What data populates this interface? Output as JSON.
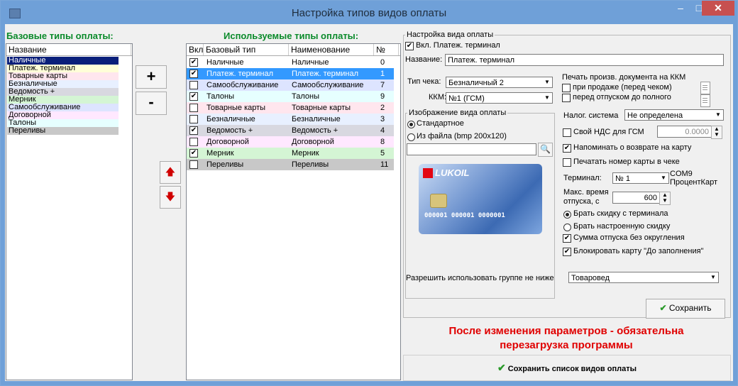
{
  "window": {
    "title": "Настройка типов видов оплаты",
    "min": "–",
    "max": "□",
    "close": "✕"
  },
  "base_types": {
    "header": "Базовые типы оплаты:",
    "column": "Название",
    "items": [
      "Наличные",
      "Платеж. терминал",
      "Товарные карты",
      "Безналичные",
      "Ведомость +",
      "Мерник",
      "Самообслуживание",
      "Договорной",
      "Талоны",
      "Переливы"
    ],
    "colors": [
      "#0a1f7a",
      "#ffffd8",
      "#ffe6ee",
      "#e8f0ff",
      "#d8d8e0",
      "#d4f5d4",
      "#dde4ff",
      "#ffe8ff",
      "#e6ffff",
      "#c8c8c8"
    ]
  },
  "buttons": {
    "add": "+",
    "remove": "-",
    "up": "🡅",
    "down": "🡇"
  },
  "used_types": {
    "header": "Используемые типы оплаты:",
    "columns": [
      "Вкл",
      "Базовый тип",
      "Наименование",
      "№"
    ],
    "rows": [
      {
        "checked": "✔",
        "base": "Наличные",
        "name": "Наличные",
        "num": "0",
        "color": "#ffffff"
      },
      {
        "checked": "✔",
        "base": "Платеж. терминал",
        "name": "Платеж. терминал",
        "num": "1",
        "color": "#3399ff"
      },
      {
        "checked": "",
        "base": "Самообслуживание",
        "name": "Самообслуживание",
        "num": "7",
        "color": "#dde4ff"
      },
      {
        "checked": "✔",
        "base": "Талоны",
        "name": "Талоны",
        "num": "9",
        "color": "#e6ffff"
      },
      {
        "checked": "",
        "base": "Товарные карты",
        "name": "Товарные карты",
        "num": "2",
        "color": "#ffe6ee"
      },
      {
        "checked": "",
        "base": "Безналичные",
        "name": "Безналичные",
        "num": "3",
        "color": "#e8f0ff"
      },
      {
        "checked": "✔",
        "base": "Ведомость +",
        "name": "Ведомость +",
        "num": "4",
        "color": "#d8d8e0"
      },
      {
        "checked": "",
        "base": "Договорной",
        "name": "Договорной",
        "num": "8",
        "color": "#ffe8ff"
      },
      {
        "checked": "✔",
        "base": "Мерник",
        "name": "Мерник",
        "num": "5",
        "color": "#d4f5d4"
      },
      {
        "checked": "",
        "base": "Переливы",
        "name": "Переливы",
        "num": "11",
        "color": "#c8c8c8"
      }
    ]
  },
  "settings": {
    "group_title": "Настройка вида оплаты",
    "enabled_label": "Вкл. Платеж. терминал",
    "name_label": "Название:",
    "name_value": "Платеж. терминал",
    "receipt_type_label": "Тип чека:",
    "receipt_type_value": "Безналичный 2",
    "kkm_label": "ККМ:",
    "kkm_value": "№1 (ГСМ)",
    "print_title": "Печать произв. документа на ККМ",
    "print_on_sale": "при продаже (перед чеком)",
    "print_before_full": "перед отпуском до полного",
    "image_group_title": "Изображение вида оплаты",
    "image_standard": "Стандартное",
    "image_file": "Из файла (bmp 200x120)",
    "file_path": "",
    "card_brand": "LUKOIL",
    "card_number": "000001 000001 0000001",
    "tax_label": "Налог. система",
    "tax_value": "Не определена",
    "own_vat_label": "Свой НДС для ГСМ",
    "own_vat_value": "0.0000",
    "remind_return": "Напоминать о возврате на карту",
    "print_card_number": "Печатать номер карты в чеке",
    "terminal_label": "Терминал:",
    "terminal_value": "№ 1",
    "terminal_info": "COM9\nПроцентКарт",
    "max_time_label": "Макс. время\nотпуска, с",
    "max_time_value": "600",
    "discount_terminal": "Брать скидку с терминала",
    "discount_configured": "Брать настроенную скидку",
    "sum_no_rounding": "Сумма отпуска без округления",
    "block_card": "Блокировать карту \"До заполнения\"",
    "group_allow_label": "Разрешить использовать группе не ниже",
    "group_allow_value": "Товаровед",
    "save_label": "Сохранить"
  },
  "warning": "После изменения параметров - обязательна\nперезагрузка программы",
  "save_list_label": "Сохранить список видов оплаты",
  "colors": {
    "title_bg": "#6fa0d8",
    "green_header": "#0a8a2a",
    "warning": "#e00000",
    "selected": "#0a1f7a"
  }
}
